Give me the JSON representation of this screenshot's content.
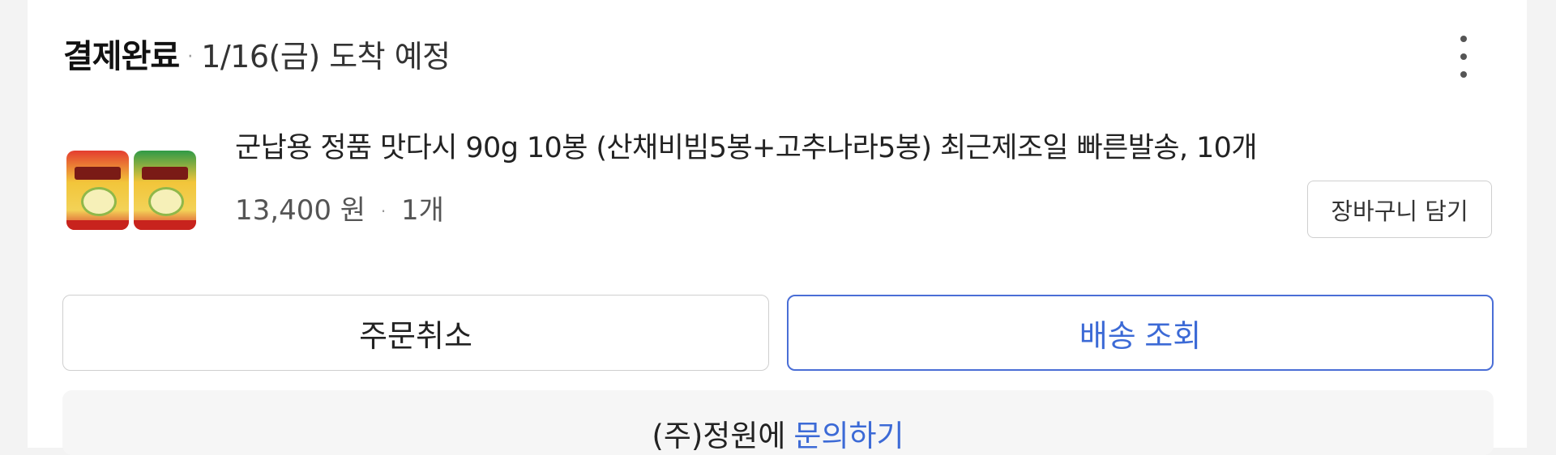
{
  "order": {
    "status": "결제완료",
    "separator": "·",
    "delivery": "1/16(금) 도착 예정"
  },
  "icons": {
    "more": "more-vertical-icon",
    "thumbnail": "product-thumbnail"
  },
  "product": {
    "name": "군납용 정품 맛다시 90g 10봉 (산채비빔5봉+고추나라5봉) 최근제조일 빠른발송, 10개",
    "price": "13,400 원",
    "separator": "·",
    "quantity": "1개",
    "add_to_cart": "장바구니 담기"
  },
  "actions": {
    "cancel": "주문취소",
    "track": "배송 조회"
  },
  "inquiry": {
    "seller": "(주)정원에",
    "link": "문의하기"
  },
  "colors": {
    "accent": "#3c6ad6",
    "background": "#f3f3f3"
  }
}
